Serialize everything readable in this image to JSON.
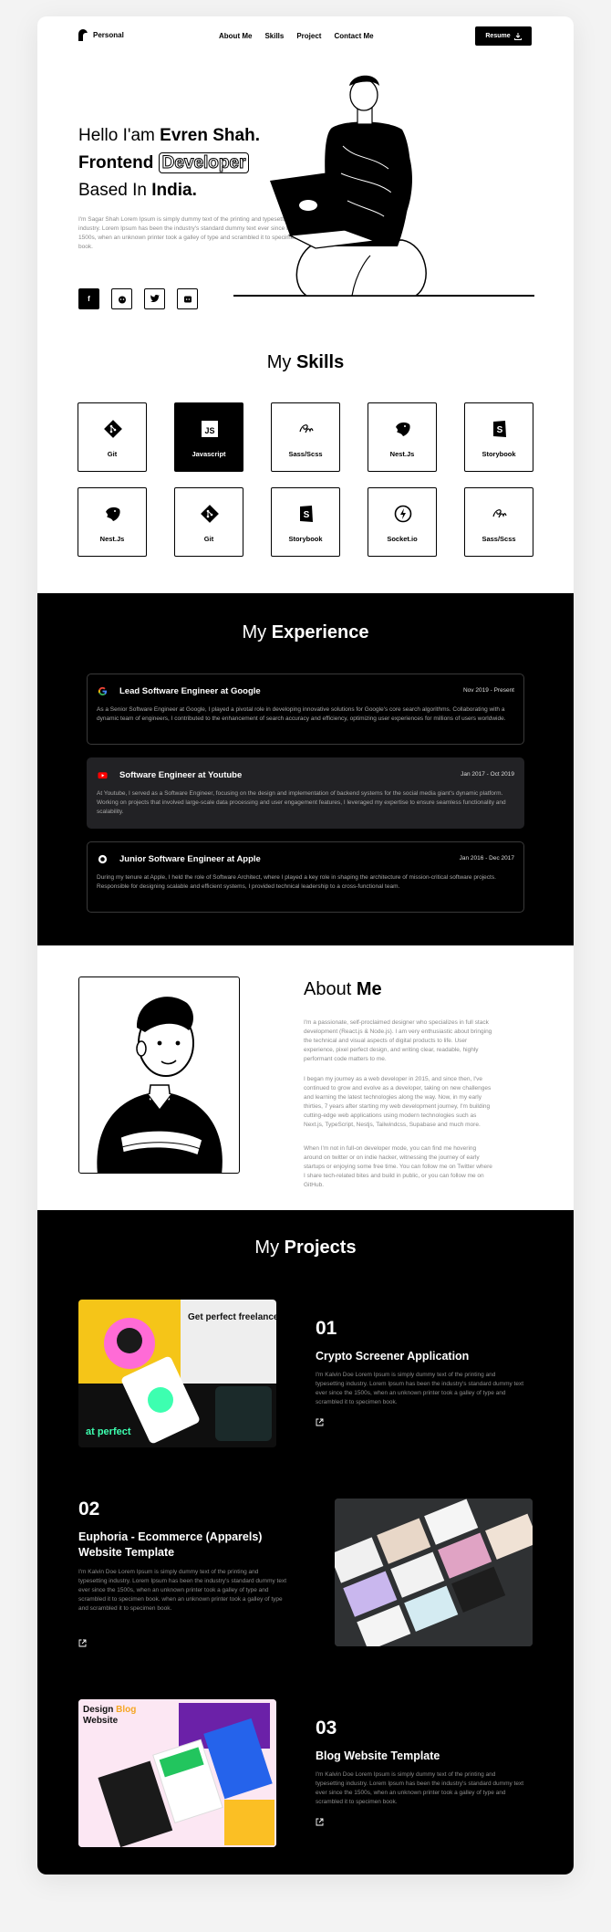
{
  "header": {
    "logo_text": "Personal",
    "nav": [
      "About Me",
      "Skills",
      "Project",
      "Contact Me"
    ],
    "resume_label": "Resume"
  },
  "hero": {
    "line1_prefix": "Hello I'am ",
    "line1_name": "Evren Shah.",
    "line2_word": "Frontend",
    "line2_outline": "Developer",
    "line3_prefix": "Based In ",
    "line3_place": "India.",
    "description": "I'm Sagar Shah Lorem Ipsum is simply dummy text of the printing and typesetting industry. Lorem Ipsum has been the industry's standard dummy text ever since the 1500s, when an unknown printer took a galley of type and scrambled it to specimen book.",
    "socials": [
      "facebook-icon",
      "reddit-icon",
      "twitter-icon",
      "discord-icon"
    ]
  },
  "skills": {
    "title_prefix": "My ",
    "title_bold": "Skills",
    "items": [
      {
        "label": "Git",
        "icon": "git-icon"
      },
      {
        "label": "Javascript",
        "icon": "javascript-icon",
        "active": true
      },
      {
        "label": "Sass/Scss",
        "icon": "sass-icon"
      },
      {
        "label": "Nest.Js",
        "icon": "nestjs-icon"
      },
      {
        "label": "Storybook",
        "icon": "storybook-icon"
      },
      {
        "label": "Nest.Js",
        "icon": "nestjs-icon"
      },
      {
        "label": "Git",
        "icon": "git-icon"
      },
      {
        "label": "Storybook",
        "icon": "storybook-icon"
      },
      {
        "label": "Socket.io",
        "icon": "socketio-icon"
      },
      {
        "label": "Sass/Scss",
        "icon": "sass-icon"
      }
    ]
  },
  "experience": {
    "title_prefix": "My ",
    "title_bold": "Experience",
    "items": [
      {
        "title": "Lead Software Engineer at Google",
        "date": "Nov 2019 - Present",
        "icon": "google-icon",
        "description": "As a Senior Software Engineer at Google, I played a pivotal role in developing innovative solutions for Google's core search algorithms. Collaborating with a dynamic team of engineers, I contributed to the enhancement of search accuracy and efficiency, optimizing user experiences for millions of users worldwide."
      },
      {
        "title": "Software Engineer at Youtube",
        "date": "Jan 2017 - Oct 2019",
        "icon": "youtube-icon",
        "description": "At Youtube, I served as a Software Engineer, focusing on the design and implementation of backend systems for the social media giant's dynamic platform. Working on projects that involved large-scale data processing and user engagement features, I leveraged my expertise to ensure seamless functionality and scalability."
      },
      {
        "title": "Junior Software Engineer at Apple",
        "date": "Jan 2016 - Dec 2017",
        "icon": "apple-icon",
        "description": "During my tenure at Apple, I held the role of Software Architect, where I played a key role in shaping the architecture of mission-critical software projects. Responsible for designing scalable and efficient systems, I provided technical leadership to a cross-functional team."
      }
    ]
  },
  "about": {
    "title_prefix": "About ",
    "title_bold": "Me",
    "paragraphs": [
      "I'm a passionate, self-proclaimed designer who specializes in full stack development (React.js & Node.js). I am very enthusiastic about bringing the technical and visual aspects of digital products to life. User experience, pixel perfect design, and writing clear, readable, highly performant code matters to me.",
      "I began my journey as a web developer in 2015, and since then, I've continued to grow and evolve as a developer, taking on new challenges and learning the latest technologies along the way. Now, in my early thirties, 7 years after starting my web development journey, I'm building cutting-edge web applications using modern technologies such as Next.js, TypeScript, Nestjs, Tailwindcss, Supabase and much more.",
      "When I'm not in full-on developer mode, you can find me hovering around on twitter or on indie hacker, witnessing the journey of early startups or enjoying some free time. You can follow me on Twitter where I share tech-related bites and build in public, or you can follow me on GitHub."
    ]
  },
  "projects": {
    "title_prefix": "My ",
    "title_bold": "Projects",
    "items": [
      {
        "number": "01",
        "title": "Crypto Screener Application",
        "description": "I'm Kalvin Doe Lorem Ipsum is simply dummy text of the printing and typesetting industry. Lorem Ipsum has been the industry's standard dummy text ever since the 1500s, when an unknown printer took a galley of type and scrambled it to specimen book.",
        "image_text": "Get perfect freelancer for your projects"
      },
      {
        "number": "02",
        "title": "Euphoria - Ecommerce (Apparels) Website Template",
        "description": "I'm Kalvin Doe Lorem Ipsum is simply dummy text of the printing and typesetting industry. Lorem Ipsum has been the industry's standard dummy text ever since the 1500s, when an unknown printer took a galley of type and scrambled it to specimen book. when an unknown printer took a galley of type and scrambled it to specimen book."
      },
      {
        "number": "03",
        "title": "Blog Website Template",
        "description": "I'm Kalvin Doe Lorem Ipsum is simply dummy text of the printing and typesetting industry. Lorem Ipsum has been the industry's standard dummy text ever since the 1500s, when an unknown printer took a galley of type and scrambled it to specimen book.",
        "image_title_1": "Design",
        "image_title_accent": "Blog",
        "image_title_2": "Website"
      }
    ]
  },
  "colors": {
    "accent_yellow": "#f5c518",
    "accent_green": "#3dffb0",
    "dark": "#000000"
  }
}
